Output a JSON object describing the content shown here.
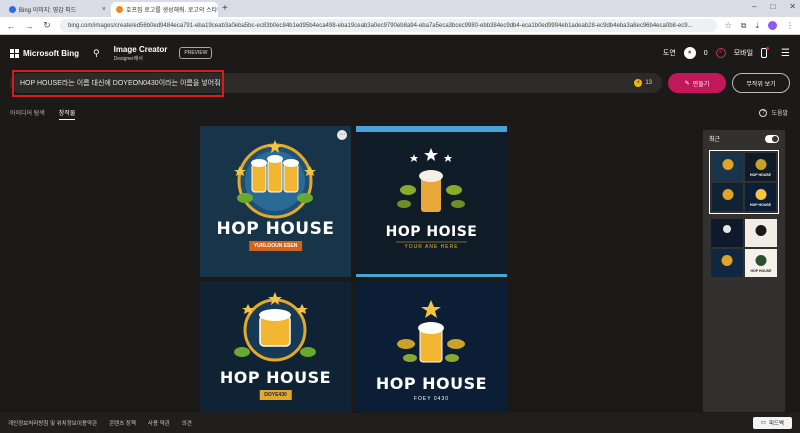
{
  "browser": {
    "tabs": [
      {
        "title": "Bing 이미지: 영감 피드",
        "active": false
      },
      {
        "title": "호프집 로고를 생성해줘. 로고의 스타일은",
        "active": true
      }
    ],
    "new_tab": "+",
    "url": "bing.com/images/create/ed56b0ed9484eca791-eba19ceab3a0eba5bc-ec83b0ec84b1ed95b4eca498-eba19ceab3a0ec9790eb8a94-eba7a5eca3bcec9980-ebb384ec9db4-eca1b0ed9994eb1adeab28-ec9db4eba3a8ec96b4eca0b8-ec9..."
  },
  "header": {
    "brand": "Microsoft Bing",
    "product": "Image Creator",
    "product_sub": "Designer제서",
    "badge": "PREVIEW",
    "user_name": "도연",
    "reward_count": "0",
    "mobile_label": "모바일"
  },
  "prompt": {
    "text": "HOP HOUSE라는 이름 대신에 DOYEON0430이라는 이름을 넣어줘",
    "boost_count": "13",
    "create_label": "만들기",
    "surprise_label": "무작위 보기"
  },
  "subtabs": [
    {
      "label": "아이디어 탐색",
      "active": false
    },
    {
      "label": "창작물",
      "active": true
    }
  ],
  "help_label": "도움말",
  "results": [
    {
      "title": "HOP HOUSE",
      "banner": "YURLOOUN ESEN"
    },
    {
      "title": "HOP HOISE",
      "subtitle": "YOUR ANE HERE"
    },
    {
      "title": "HOP HOUSE",
      "banner": "DOYE430"
    },
    {
      "title": "HOP HOUSE",
      "subtitle": "FOEY  0430"
    }
  ],
  "recent": {
    "label": "최근",
    "group1": [
      "",
      "HOP HOUSE",
      "",
      "HOP HOUSE"
    ],
    "group2": [
      "",
      "",
      "",
      "HOP HOUSE"
    ]
  },
  "footer": {
    "links": [
      "개인정보처리방침 및 위치정보이용약관",
      "콘텐츠 정책",
      "사용 약관",
      "의견"
    ],
    "feedback_label": "피드백"
  }
}
